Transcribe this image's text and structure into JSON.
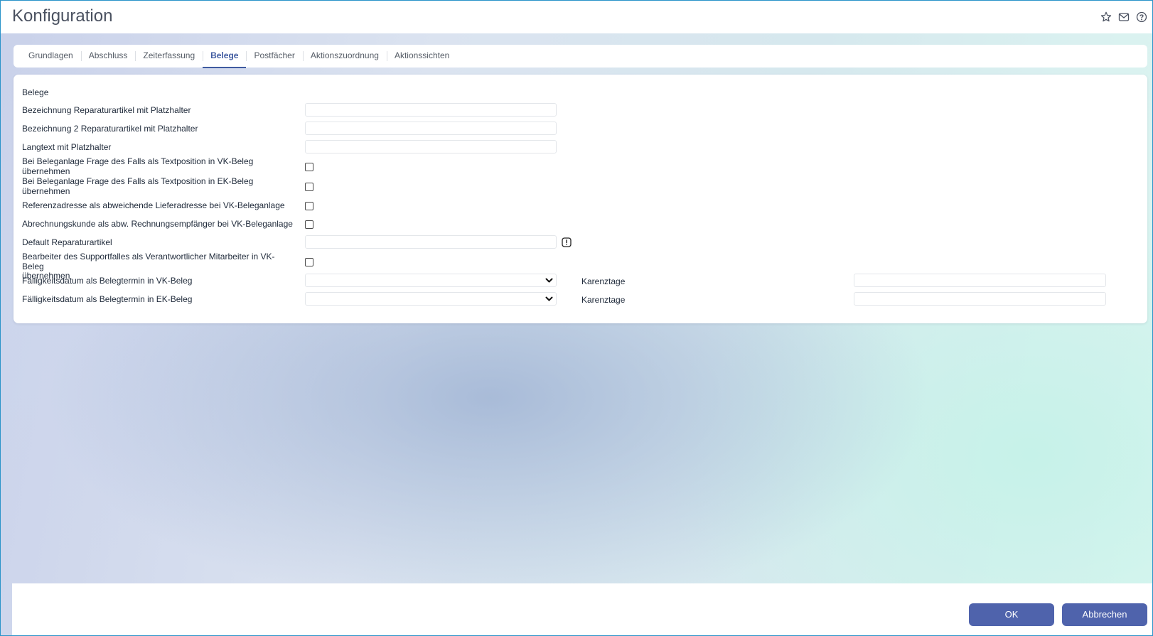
{
  "window": {
    "title": "Konfiguration",
    "icons": [
      "star-icon",
      "mail-icon",
      "help-icon"
    ]
  },
  "tabs": [
    {
      "label": "Grundlagen"
    },
    {
      "label": "Abschluss"
    },
    {
      "label": "Zeiterfassung"
    },
    {
      "label": "Belege",
      "active": true
    },
    {
      "label": "Postfächer"
    },
    {
      "label": "Aktionszuordnung"
    },
    {
      "label": "Aktionssichten"
    }
  ],
  "form": {
    "section_title": "Belege",
    "bezeichnung_label": "Bezeichnung Reparaturartikel mit Platzhalter",
    "bezeichnung_value": "",
    "bezeichnung2_label": "Bezeichnung 2 Reparaturartikel mit Platzhalter",
    "bezeichnung2_value": "",
    "langtext_label": "Langtext mit Platzhalter",
    "langtext_value": "",
    "vk_textposition_label_line1": "Bei Beleganlage Frage des Falls als Textposition in VK-Beleg",
    "vk_textposition_label_line2": "übernehmen",
    "vk_textposition_checked": false,
    "ek_textposition_label_line1": "Bei Beleganlage Frage des Falls als Textposition in EK-Beleg",
    "ek_textposition_label_line2": "übernehmen",
    "ek_textposition_checked": false,
    "referenzadresse_label": "Referenzadresse als abweichende Lieferadresse bei VK-Beleganlage",
    "referenzadresse_checked": false,
    "abrechnungskunde_label": "Abrechnungskunde als abw. Rechnungsempfänger bei VK-Beleganlage",
    "abrechnungskunde_checked": false,
    "default_artikel_label": "Default Reparaturartikel",
    "default_artikel_value": "",
    "bearbeiter_label_line1": "Bearbeiter des Supportfalles als Verantwortlicher Mitarbeiter in VK-Beleg",
    "bearbeiter_label_line2": "übernehmen",
    "bearbeiter_checked": false,
    "faelligkeit_vk_label": "Fälligkeitsdatum als Belegtermin in VK-Beleg",
    "faelligkeit_vk_value": "",
    "karenztage_vk_label": "Karenztage",
    "karenztage_vk_value": "",
    "faelligkeit_ek_label": "Fälligkeitsdatum als Belegtermin in EK-Beleg",
    "faelligkeit_ek_value": "",
    "karenztage_ek_label": "Karenztage",
    "karenztage_ek_value": ""
  },
  "footer": {
    "ok_label": "OK",
    "cancel_label": "Abbrechen"
  },
  "colors": {
    "accent": "#3f5aa0",
    "button": "#4f63ac",
    "window_border": "#2a93c9"
  }
}
